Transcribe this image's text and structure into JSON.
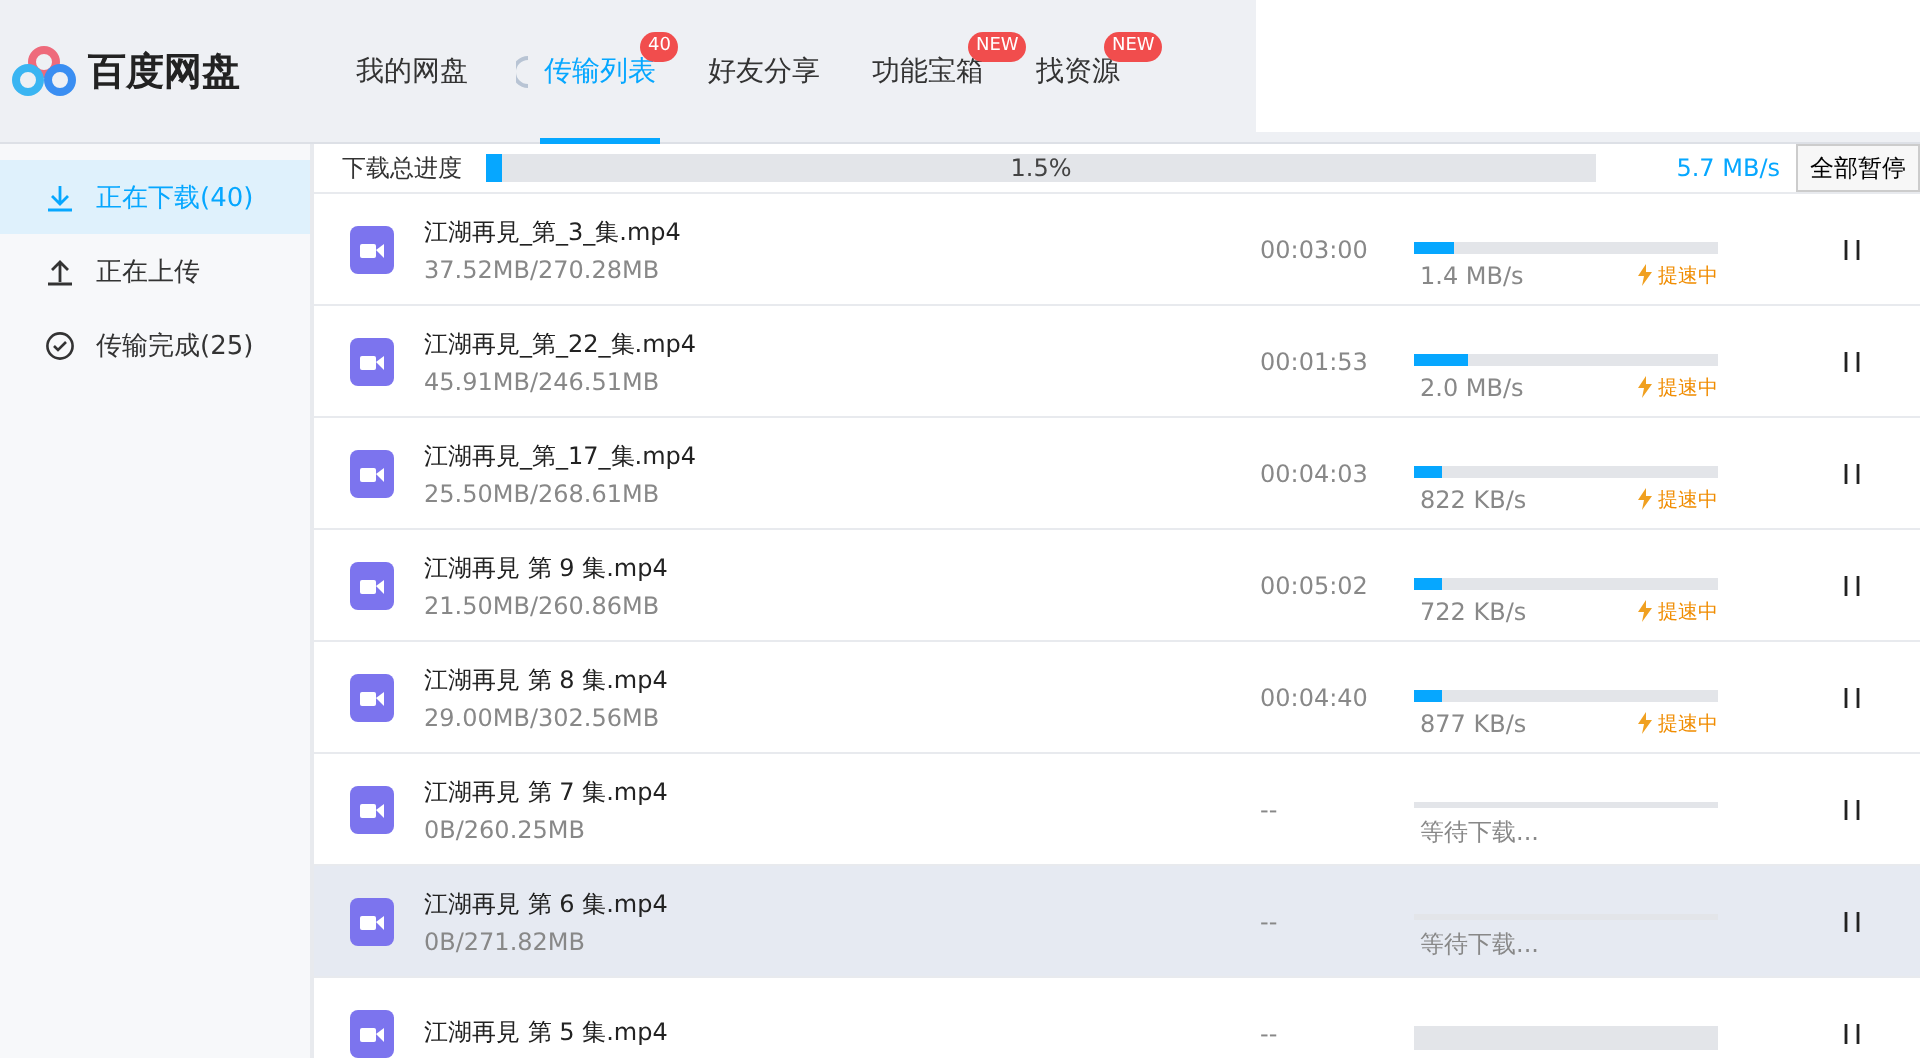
{
  "app": {
    "name": "百度网盘"
  },
  "nav_tabs": [
    {
      "label": "我的网盘",
      "selected": false
    },
    {
      "label": "传输列表",
      "selected": true,
      "badge": "40",
      "loading": true
    },
    {
      "label": "好友分享",
      "selected": false
    },
    {
      "label": "功能宝箱",
      "selected": false,
      "badge": "NEW"
    },
    {
      "label": "找资源",
      "selected": false,
      "badge": "NEW"
    }
  ],
  "sidebar": {
    "items": [
      {
        "label": "正在下载(40)",
        "selected": true
      },
      {
        "label": "正在上传",
        "selected": false
      },
      {
        "label": "传输完成(25)",
        "selected": false
      }
    ]
  },
  "summary": {
    "label": "下载总进度",
    "level": 0.015,
    "percent": "1.5%",
    "speed": "5.7 MB/s",
    "button": "全部暂停"
  },
  "downloads": [
    {
      "name": "江湖再見_第_3_集.mp4",
      "size": "37.52MB/270.28MB",
      "time": "00:03:00",
      "kind": "downloading",
      "level": 0.13,
      "speed": "1.4 MB/s",
      "boost": "提速中",
      "selected": false
    },
    {
      "name": "江湖再見_第_22_集.mp4",
      "size": "45.91MB/246.51MB",
      "time": "00:01:53",
      "kind": "downloading",
      "level": 0.18,
      "speed": "2.0 MB/s",
      "boost": "提速中",
      "selected": false
    },
    {
      "name": "江湖再見_第_17_集.mp4",
      "size": "25.50MB/268.61MB",
      "time": "00:04:03",
      "kind": "downloading",
      "level": 0.09,
      "speed": "822 KB/s",
      "boost": "提速中",
      "selected": false
    },
    {
      "name": "江湖再見 第 9 集.mp4",
      "size": "21.50MB/260.86MB",
      "time": "00:05:02",
      "kind": "downloading",
      "level": 0.09,
      "speed": "722 KB/s",
      "boost": "提速中",
      "selected": false
    },
    {
      "name": "江湖再見 第 8 集.mp4",
      "size": "29.00MB/302.56MB",
      "time": "00:04:40",
      "kind": "downloading",
      "level": 0.09,
      "speed": "877 KB/s",
      "boost": "提速中",
      "selected": false
    },
    {
      "name": "江湖再見 第 7 集.mp4",
      "size": "0B/260.25MB",
      "time": "--",
      "kind": "waiting",
      "status": "等待下载...",
      "selected": false
    },
    {
      "name": "江湖再見 第 6 集.mp4",
      "size": "0B/271.82MB",
      "time": "--",
      "kind": "waiting",
      "status": "等待下载...",
      "selected": true
    },
    {
      "name": "江湖再見 第 5 集.mp4",
      "time": "--",
      "kind": "waiting",
      "selected": false
    }
  ]
}
